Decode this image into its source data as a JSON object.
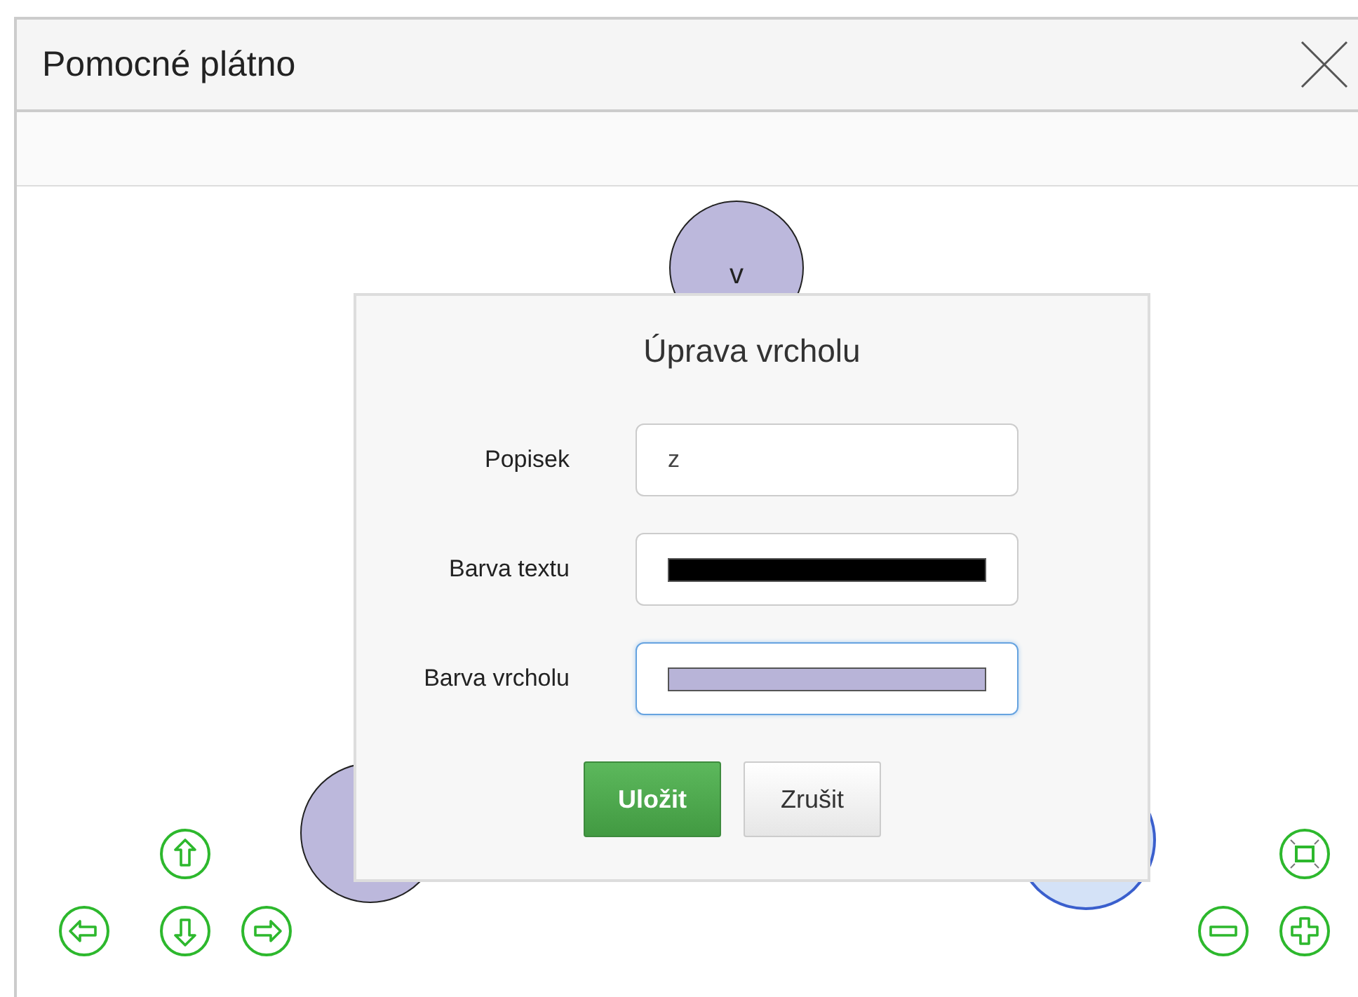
{
  "window": {
    "title": "Pomocné plátno"
  },
  "canvas": {
    "nodes": [
      {
        "label": "v",
        "color": "#bcb8dc",
        "selected": false
      },
      {
        "color": "#bcb8dc",
        "selected": false
      },
      {
        "color": "#d4e2f7",
        "selected": true
      }
    ]
  },
  "dialog": {
    "title": "Úprava vrcholu",
    "fields": [
      {
        "kind": "text",
        "label": "Popisek",
        "value": "z",
        "focused": false
      },
      {
        "kind": "color",
        "label": "Barva textu",
        "color": "#000000",
        "focused": false
      },
      {
        "kind": "color",
        "label": "Barva vrcholu",
        "color": "#b8b4d8",
        "focused": true
      }
    ],
    "buttons": [
      {
        "kind": "primary",
        "label": "Uložit"
      },
      {
        "kind": "secondary",
        "label": "Zrušit"
      }
    ]
  }
}
